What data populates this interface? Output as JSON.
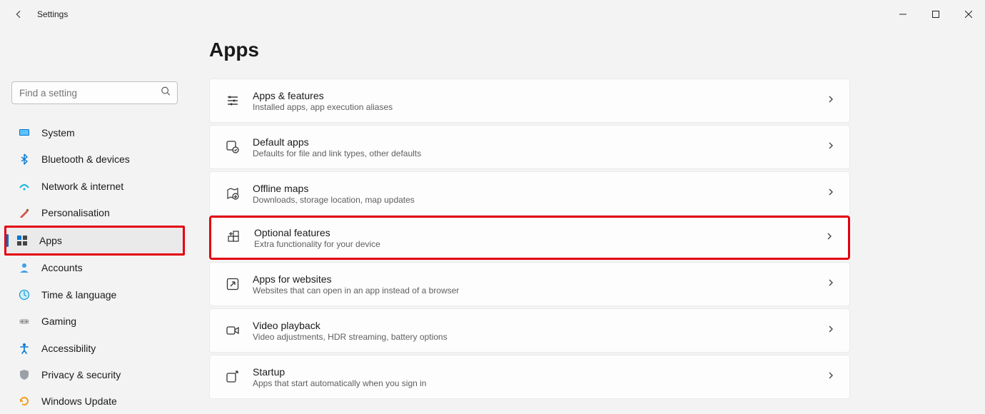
{
  "window": {
    "title": "Settings"
  },
  "search": {
    "placeholder": "Find a setting"
  },
  "nav": {
    "items": [
      {
        "label": "System"
      },
      {
        "label": "Bluetooth & devices"
      },
      {
        "label": "Network & internet"
      },
      {
        "label": "Personalisation"
      },
      {
        "label": "Apps",
        "selected": true,
        "highlighted": true
      },
      {
        "label": "Accounts"
      },
      {
        "label": "Time & language"
      },
      {
        "label": "Gaming"
      },
      {
        "label": "Accessibility"
      },
      {
        "label": "Privacy & security"
      },
      {
        "label": "Windows Update"
      }
    ]
  },
  "page": {
    "title": "Apps"
  },
  "cards": [
    {
      "title": "Apps & features",
      "desc": "Installed apps, app execution aliases"
    },
    {
      "title": "Default apps",
      "desc": "Defaults for file and link types, other defaults"
    },
    {
      "title": "Offline maps",
      "desc": "Downloads, storage location, map updates"
    },
    {
      "title": "Optional features",
      "desc": "Extra functionality for your device",
      "highlighted": true
    },
    {
      "title": "Apps for websites",
      "desc": "Websites that can open in an app instead of a browser"
    },
    {
      "title": "Video playback",
      "desc": "Video adjustments, HDR streaming, battery options"
    },
    {
      "title": "Startup",
      "desc": "Apps that start automatically when you sign in"
    }
  ]
}
